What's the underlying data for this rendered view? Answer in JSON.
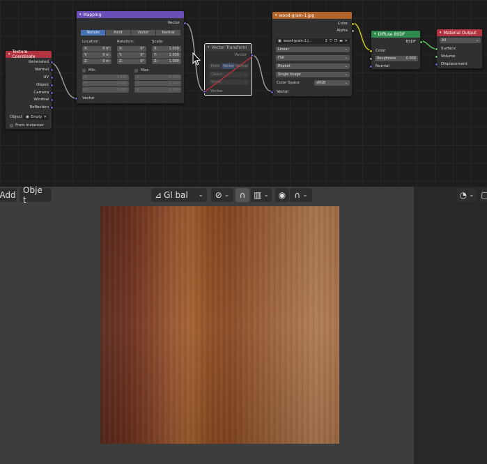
{
  "nodes": {
    "texture_coordinate": {
      "title": "Texture Coordinate",
      "outputs": [
        "Generated",
        "Normal",
        "UV",
        "Object",
        "Camera",
        "Window",
        "Reflection"
      ],
      "object_label": "Object",
      "object_value": "Empty",
      "from_instancer": "From Instancer"
    },
    "mapping": {
      "title": "Mapping",
      "output": "Vector",
      "tabs": [
        "Texture",
        "Point",
        "Vector",
        "Normal"
      ],
      "active_tab": "Texture",
      "location_label": "Location:",
      "rotation_label": "Rotation:",
      "scale_label": "Scale:",
      "location": [
        {
          "axis": "X:",
          "value": "0 m"
        },
        {
          "axis": "Y:",
          "value": "0 m"
        },
        {
          "axis": "Z:",
          "value": "0 m"
        }
      ],
      "rotation": [
        {
          "axis": "X:",
          "value": "0°"
        },
        {
          "axis": "Y:",
          "value": "0°"
        },
        {
          "axis": "Z:",
          "value": "0°"
        }
      ],
      "scale": [
        {
          "axis": "X:",
          "value": "1.000"
        },
        {
          "axis": "Y:",
          "value": "1.000"
        },
        {
          "axis": "Z:",
          "value": "1.000"
        }
      ],
      "min_label": "Min",
      "max_label": "Max",
      "min": [
        {
          "axis": "X:",
          "value": "1.800"
        },
        {
          "axis": "Y:",
          "value": "2.600"
        },
        {
          "axis": "Z:",
          "value": "0.000"
        }
      ],
      "max": [
        {
          "axis": "X:",
          "value": "8.400"
        },
        {
          "axis": "Y:",
          "value": "1.000"
        },
        {
          "axis": "Z:",
          "value": "1.000"
        }
      ],
      "input": "Vector"
    },
    "vector_transform": {
      "title": "Vector Transform",
      "output": "Vector",
      "tabs": [
        "Point",
        "Vector",
        "Normal"
      ],
      "active_tab": "Vector",
      "from": "Object",
      "to": "World",
      "input": "Vector"
    },
    "image_texture": {
      "title": "wood-grain-1.jpg",
      "outputs": [
        "Color",
        "Alpha"
      ],
      "image_name": "wood-grain-1.j...",
      "users": "2",
      "interpolation": "Linear",
      "projection": "Flat",
      "extension": "Repeat",
      "source": "Single Image",
      "color_space_label": "Color Space",
      "color_space": "sRGB",
      "input": "Vector"
    },
    "diffuse_bsdf": {
      "title": "Diffuse BSDF",
      "output": "BSDF",
      "color": "Color",
      "roughness_label": "Roughness",
      "roughness": "0.000",
      "normal": "Normal"
    },
    "material_output": {
      "title": "Material Output",
      "target": "All",
      "inputs": [
        "Surface",
        "Volume",
        "Displacement"
      ]
    }
  },
  "viewport_header": {
    "add": "Add",
    "object": "Obje t",
    "orientation": "Gl bal"
  },
  "colors": {
    "editor_bg": "#1d1d1d",
    "viewport_bg": "#3d3d3d",
    "sidebar_bg": "#282828",
    "texture_coordinate_header": "#b33440",
    "mapping_header": "#6a4fb8",
    "image_header": "#b3642a",
    "bsdf_header": "#2f8a4e",
    "active_tab": "#4772b3"
  }
}
